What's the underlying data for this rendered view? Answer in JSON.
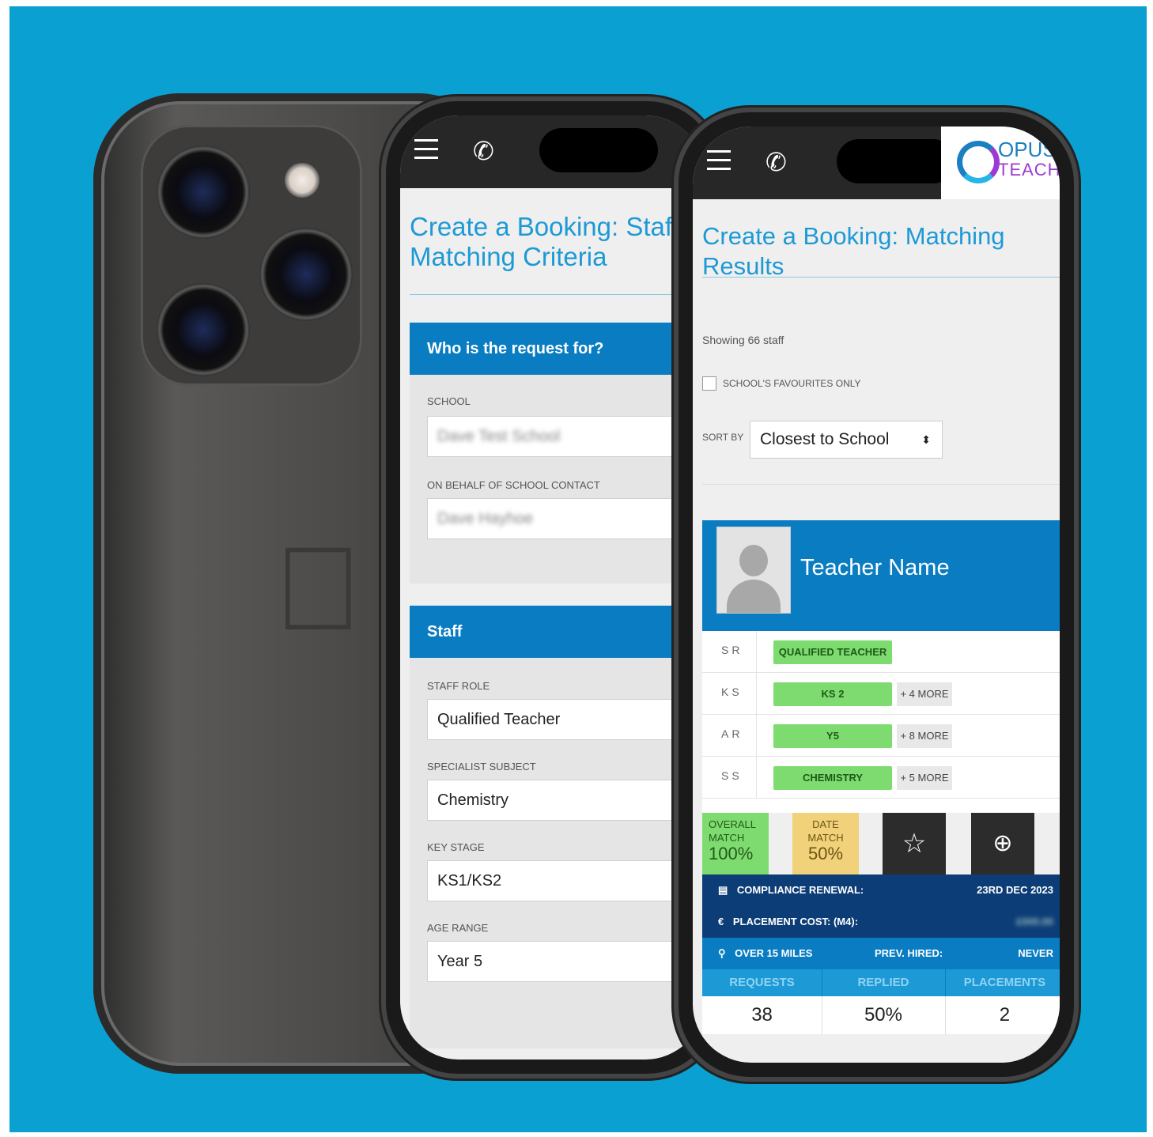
{
  "phone1": {
    "page_title": "Create a Booking: Staff Matching Criteria",
    "panel_request": {
      "header": "Who is the request for?",
      "school_label": "SCHOOL",
      "school_value": "Dave Test School",
      "contact_label": "ON BEHALF OF SCHOOL CONTACT",
      "contact_value": "Dave Hayhoe"
    },
    "panel_staff": {
      "header": "Staff",
      "role_label": "STAFF ROLE",
      "role_value": "Qualified Teacher",
      "subject_label": "SPECIALIST SUBJECT",
      "subject_value": "Chemistry",
      "stage_label": "KEY STAGE",
      "stage_value": "KS1/KS2",
      "age_label": "AGE RANGE",
      "age_value": "Year 5"
    }
  },
  "phone2": {
    "logo": {
      "line1": "OPUS",
      "line2": "TEACH"
    },
    "page_title": "Create a Booking: Matching Results",
    "showing": "Showing 66 staff",
    "favourites_label": "SCHOOL'S FAVOURITES ONLY",
    "sort_label": "SORT BY",
    "sort_value": "Closest to School",
    "teacher_name": "Teacher Name",
    "rows": [
      {
        "label": "SR",
        "tag": "QUALIFIED TEACHER",
        "more": ""
      },
      {
        "label": "KS",
        "tag": "KS 2",
        "more": "+ 4 MORE"
      },
      {
        "label": "AR",
        "tag": "Y5",
        "more": "+ 8 MORE"
      },
      {
        "label": "SS",
        "tag": "CHEMISTRY",
        "more": "+ 5 MORE"
      }
    ],
    "overall_match": {
      "label1": "OVERALL",
      "label2": "MATCH",
      "value": "100%"
    },
    "date_match": {
      "label1": "DATE",
      "label2": "MATCH",
      "value": "50%"
    },
    "compliance_label": "COMPLIANCE RENEWAL:",
    "compliance_value": "23RD DEC 2023",
    "placement_label": "PLACEMENT COST: (M4):",
    "placement_value": "£000.00",
    "distance_label": "OVER 15 MILES",
    "prev_hired_label": "PREV. HIRED:",
    "prev_hired_value": "NEVER",
    "metrics": {
      "headers": [
        "REQUESTS",
        "REPLIED",
        "PLACEMENTS"
      ],
      "values": [
        "38",
        "50%",
        "2"
      ]
    }
  },
  "icons": [
    "menu-icon",
    "phone-icon",
    "star-icon",
    "plus-icon",
    "calendar-icon",
    "euro-icon",
    "location-pin-icon"
  ],
  "colors": {
    "background": "#0aa0d2",
    "brand_blue": "#0a7dc2",
    "match_green": "#7ddb6f",
    "match_yellow": "#f1d27a",
    "navy": "#0c3d77"
  }
}
